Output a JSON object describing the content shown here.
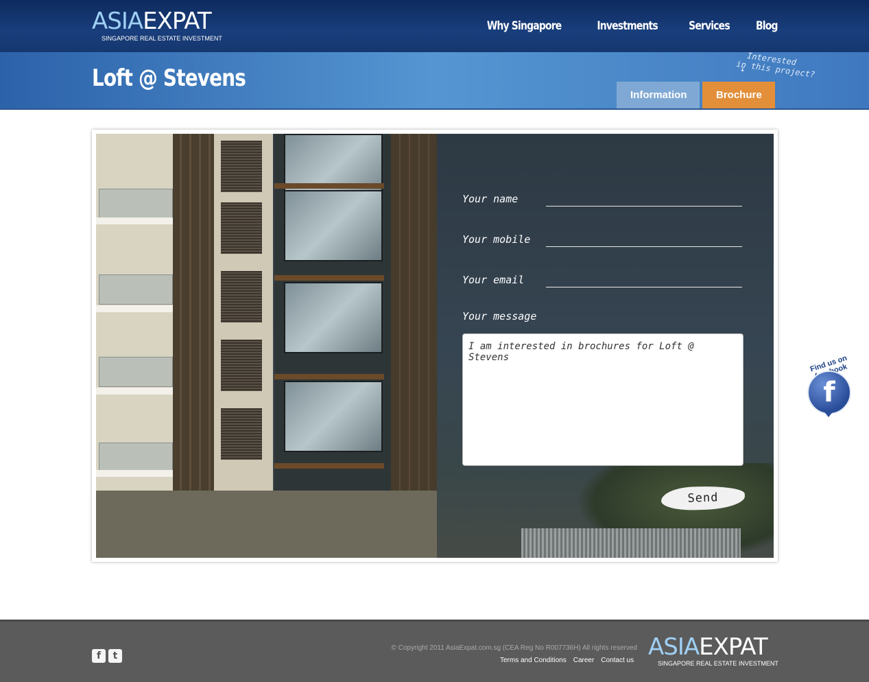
{
  "brand": {
    "asia": "ASIA",
    "expat": "EXPAT",
    "tagline": "SINGAPORE REAL ESTATE INVESTMENT"
  },
  "nav": {
    "items": [
      {
        "label": "Why Singapore"
      },
      {
        "label": "Investments"
      },
      {
        "label": "Services"
      },
      {
        "label": "Blog"
      }
    ]
  },
  "page": {
    "title": "Loft @ Stevens",
    "interested_note_line1": "Interested",
    "interested_note_line2": "in this project?",
    "tabs": {
      "information": "Information",
      "brochure": "Brochure"
    }
  },
  "form": {
    "name_label": "Your name",
    "mobile_label": "Your mobile",
    "email_label": "Your email",
    "message_label": "Your message",
    "message_value": "I am interested in brochures for Loft @ Stevens",
    "send_label": "Send"
  },
  "facebook_badge": {
    "text": "Find us on facebook",
    "glyph": "f"
  },
  "footer": {
    "social_facebook": "f",
    "social_twitter": "t",
    "copyright": "© Copyright 2011 AsiaExpat.com.sg (CEA Reg No R007736H) All rights reserved",
    "links": [
      {
        "label": "Terms and Conditions"
      },
      {
        "label": "Career"
      },
      {
        "label": "Contact us"
      }
    ]
  },
  "colors": {
    "header_bg": "#193e7c",
    "band_bg": "#4f8fcf",
    "tab_information": "#7fa9d4",
    "tab_brochure": "#e38f3a",
    "footer_bg": "#5b5b5b"
  }
}
